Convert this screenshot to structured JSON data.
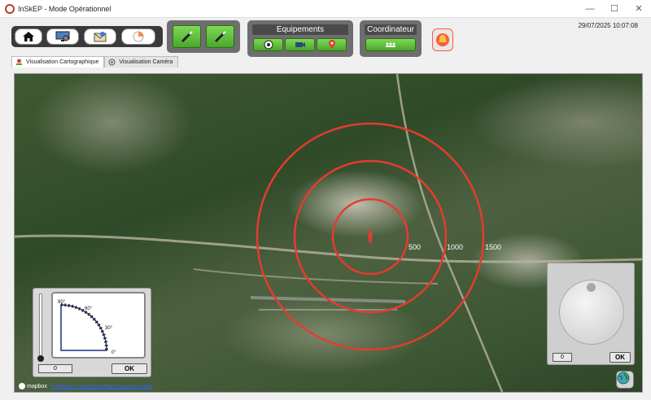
{
  "window": {
    "title": "InSkEP - Mode Opérationnel",
    "minimize": "—",
    "maximize": "☐",
    "close": "✕"
  },
  "toolbar": {
    "groups": {
      "equipements_label": "Equipements",
      "coordinateur_label": "Coordinateur"
    },
    "datetime": "29/07/2025  10:07:08",
    "colors": {
      "green": "#5bbf34",
      "alarm": "#ff5a3c"
    }
  },
  "tabs": [
    {
      "label": "Visualisation Cartographique",
      "icon": "map-icon",
      "active": true
    },
    {
      "label": "Visualisation Caméra",
      "icon": "camera-icon",
      "active": false
    }
  ],
  "map": {
    "rings": [
      {
        "label": "500",
        "color": "#e53b2f"
      },
      {
        "label": "1000",
        "color": "#e53b2f"
      },
      {
        "label": "1500",
        "color": "#e53b2f"
      }
    ],
    "logo": "mapbox",
    "attribution": "© Mapbox © OpenStreetMap  Improve this map"
  },
  "elevation_panel": {
    "angles": [
      "90°",
      "60°",
      "30°",
      "0°"
    ],
    "value": "0",
    "ok_label": "OK"
  },
  "azimuth_panel": {
    "value": "0",
    "ok_label": "OK"
  }
}
